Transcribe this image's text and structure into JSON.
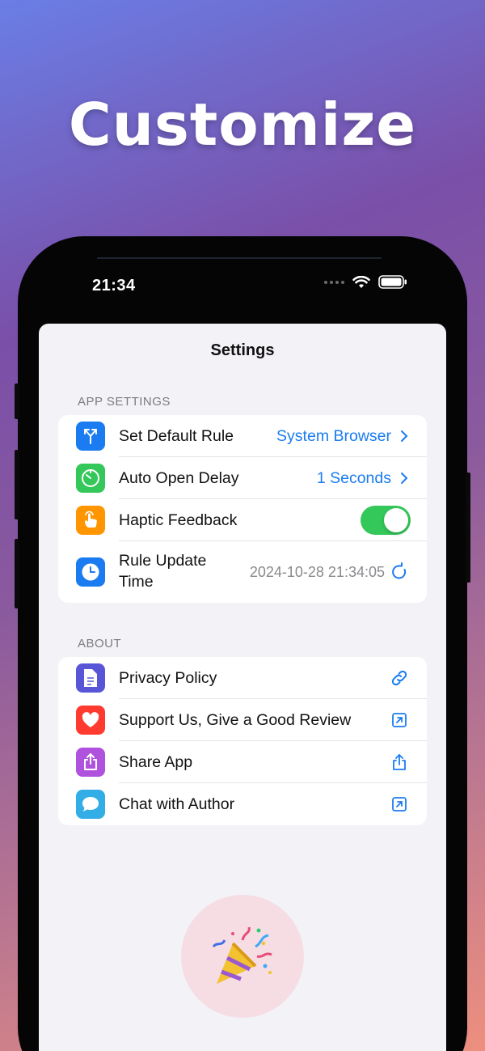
{
  "hero": {
    "title": "Customize"
  },
  "status_bar": {
    "time": "21:34"
  },
  "nav": {
    "title": "Settings"
  },
  "app_settings": {
    "header": "APP SETTINGS",
    "rows": [
      {
        "label": "Set Default Rule",
        "value": "System Browser",
        "icon": "branch-arrows-icon",
        "icon_color": "#1a7cf0"
      },
      {
        "label": "Auto Open Delay",
        "value": "1 Seconds",
        "icon": "timer-icon",
        "icon_color": "#34c759"
      },
      {
        "label": "Haptic Feedback",
        "toggle_on": true,
        "icon": "hand-tap-icon",
        "icon_color": "#ff9500"
      },
      {
        "label_line1": "Rule Update",
        "label_line2": "Time",
        "value": "2024-10-28 21:34:05",
        "icon": "clock-icon",
        "icon_color": "#1a7cf0"
      }
    ]
  },
  "about": {
    "header": "ABOUT",
    "rows": [
      {
        "label": "Privacy Policy",
        "icon": "document-icon",
        "icon_color": "#5856d6",
        "trail_icon": "link-icon"
      },
      {
        "label": "Support Us, Give a Good Review",
        "icon": "heart-icon",
        "icon_color": "#ff3b30",
        "trail_icon": "external-link-icon"
      },
      {
        "label": "Share App",
        "icon": "share-icon",
        "icon_color": "#af52de",
        "trail_icon": "share-icon"
      },
      {
        "label": "Chat with Author",
        "icon": "chat-bubble-icon",
        "icon_color": "#32ade6",
        "trail_icon": "external-link-icon"
      }
    ]
  },
  "colors": {
    "accent": "#1a7cf0",
    "toggle_on": "#34c759"
  }
}
